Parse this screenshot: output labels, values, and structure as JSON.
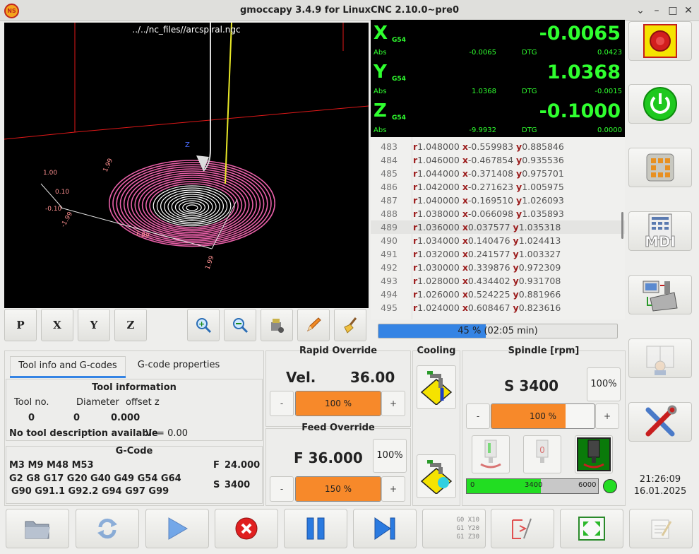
{
  "window": {
    "title": "gmoccapy  3.4.9 for LinuxCNC 2.10.0~pre0",
    "logo_text": "NS"
  },
  "preview": {
    "file_name": "../../nc_files//arcspiral.ngc",
    "axis_tick_labels": [
      "1.00",
      "1.99",
      "0.10",
      "-0.10",
      "-1.99",
      "1.99",
      "1.99",
      "1.99"
    ]
  },
  "view_toolbar": [
    "view-p",
    "view-x",
    "view-y",
    "view-z",
    "zoom-in",
    "zoom-out",
    "clear-plot-settings",
    "pencil",
    "clear-live-plot"
  ],
  "view_toolbar_labels": {
    "p": "P",
    "x": "X",
    "y": "Y",
    "z": "Z"
  },
  "dro": {
    "axes": [
      {
        "axis": "X",
        "coord": "G54",
        "value": "-0.0065",
        "abs_label": "Abs",
        "abs": "-0.0065",
        "dtg_label": "DTG",
        "dtg": "0.0423"
      },
      {
        "axis": "Y",
        "coord": "G54",
        "value": "1.0368",
        "abs_label": "Abs",
        "abs": "1.0368",
        "dtg_label": "DTG",
        "dtg": "-0.0015"
      },
      {
        "axis": "Z",
        "coord": "G54",
        "value": "-0.1000",
        "abs_label": "Abs",
        "abs": "-9.9932",
        "dtg_label": "DTG",
        "dtg": "0.0000"
      }
    ],
    "color": "#2fff2f"
  },
  "gcode_lines": [
    {
      "n": "483",
      "r": "1.048000",
      "x": "-0.559983",
      "y": "0.885846"
    },
    {
      "n": "484",
      "r": "1.046000",
      "x": "-0.467854",
      "y": "0.935536"
    },
    {
      "n": "485",
      "r": "1.044000",
      "x": "-0.371408",
      "y": "0.975701"
    },
    {
      "n": "486",
      "r": "1.042000",
      "x": "-0.271623",
      "y": "1.005975"
    },
    {
      "n": "487",
      "r": "1.040000",
      "x": "-0.169510",
      "y": "1.026093"
    },
    {
      "n": "488",
      "r": "1.038000",
      "x": "-0.066098",
      "y": "1.035893"
    },
    {
      "n": "489",
      "r": "1.036000",
      "x": "0.037577",
      "y": "1.035318"
    },
    {
      "n": "490",
      "r": "1.034000",
      "x": "0.140476",
      "y": "1.024413"
    },
    {
      "n": "491",
      "r": "1.032000",
      "x": "0.241577",
      "y": "1.003327"
    },
    {
      "n": "492",
      "r": "1.030000",
      "x": "0.339876",
      "y": "0.972309"
    },
    {
      "n": "493",
      "r": "1.028000",
      "x": "0.434402",
      "y": "0.931708"
    },
    {
      "n": "494",
      "r": "1.026000",
      "x": "0.524225",
      "y": "0.881966"
    },
    {
      "n": "495",
      "r": "1.024000",
      "x": "0.608467",
      "y": "0.823616"
    }
  ],
  "gcode_letters": {
    "r": "r",
    "x": "x",
    "y": "y"
  },
  "progress": {
    "fraction": 0.45,
    "text": "45 % (02:05 min)"
  },
  "tabs": [
    {
      "label": "Tool info and G-codes",
      "active": true
    },
    {
      "label": "G-code properties",
      "active": false
    }
  ],
  "tool_info": {
    "title": "Tool information",
    "headers": [
      "Tool no.",
      "Diameter",
      "offset z"
    ],
    "values": [
      "0",
      "0",
      "0.000"
    ],
    "description": "No tool description available",
    "vc": "Vc= 0.00"
  },
  "gcode_panel": {
    "title": "G-Code",
    "line1": "M3 M9 M48 M53",
    "line2": "G2 G8 G17 G20 G40 G49 G54 G64",
    "line3": "G90 G91.1 G92.2 G94 G97 G99",
    "feed_label": "F",
    "feed": "24.000",
    "speed_label": "S",
    "speed": "3400"
  },
  "rapid_override": {
    "title": "Rapid Override",
    "vel_label": "Vel.",
    "vel": "36.00",
    "minus": "-",
    "plus": "+",
    "bar_text": "100 %",
    "fraction": 1.0
  },
  "feed_override": {
    "title": "Feed Override",
    "feed": "F 36.000",
    "reset": "100%",
    "minus": "-",
    "plus": "+",
    "bar_text": "150 %",
    "fraction": 1.0
  },
  "cooling": {
    "title": "Cooling"
  },
  "spindle": {
    "title": "Spindle [rpm]",
    "speed": "S 3400",
    "reset": "100%",
    "minus": "-",
    "plus": "+",
    "bar_text": "100 %",
    "fraction": 0.72,
    "gauge_min": "0",
    "gauge_value": "3400",
    "gauge_max": "6000",
    "gauge_fraction": 0.567,
    "stop_label": "0"
  },
  "clock": {
    "time": "21:26:09",
    "date": "16.01.2025"
  },
  "right_buttons": [
    "estop",
    "power",
    "manual-mode",
    "mdi-mode",
    "auto-mode",
    "settings-mode",
    "tools",
    "user-tabs"
  ],
  "mdi_label": "MDI",
  "bottom_buttons": [
    "open-file",
    "reload-file",
    "run",
    "stop",
    "pause",
    "step",
    "run-from-line",
    "edit-file",
    "fullscreen",
    "notes"
  ],
  "run_from_line_text": [
    "G0 X10",
    "G1 Y20",
    "G1 Z30"
  ],
  "colors": {
    "accent_orange": "#f7892a",
    "progress_blue": "#3584e4",
    "dro_green": "#2fff2f",
    "gauge_green": "#22dd22"
  }
}
